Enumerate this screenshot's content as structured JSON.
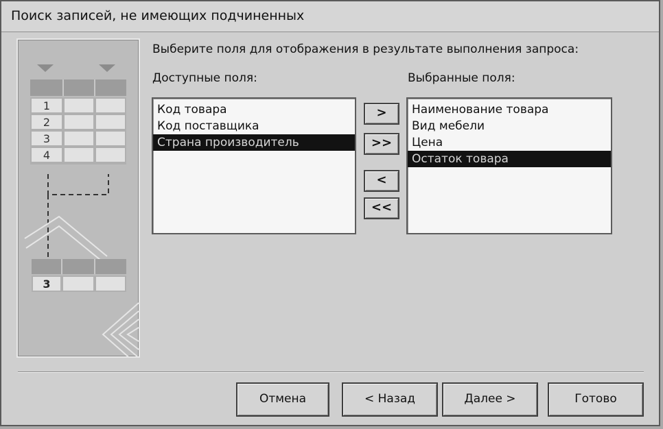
{
  "window": {
    "title": "Поиск записей, не имеющих подчиненных"
  },
  "prompt": "Выберите поля для отображения в результате выполнения запроса:",
  "available": {
    "label": "Доступные поля:",
    "items": [
      "Код товара",
      "Код поставщика",
      "Страна производитель"
    ],
    "selected_index": 2
  },
  "chosen": {
    "label": "Выбранные поля:",
    "items": [
      "Наименование товара",
      "Вид мебели",
      "Цена",
      "Остаток товара"
    ],
    "selected_index": 3
  },
  "arrows": {
    "add_one": ">",
    "add_all": ">>",
    "remove_one": "<",
    "remove_all": "<<"
  },
  "illustration": {
    "rows": [
      "1",
      "2",
      "3",
      "4"
    ],
    "result_row": "3"
  },
  "buttons": {
    "cancel": "Отмена",
    "back": "< Назад",
    "next": "Далее >",
    "finish": "Готово"
  }
}
